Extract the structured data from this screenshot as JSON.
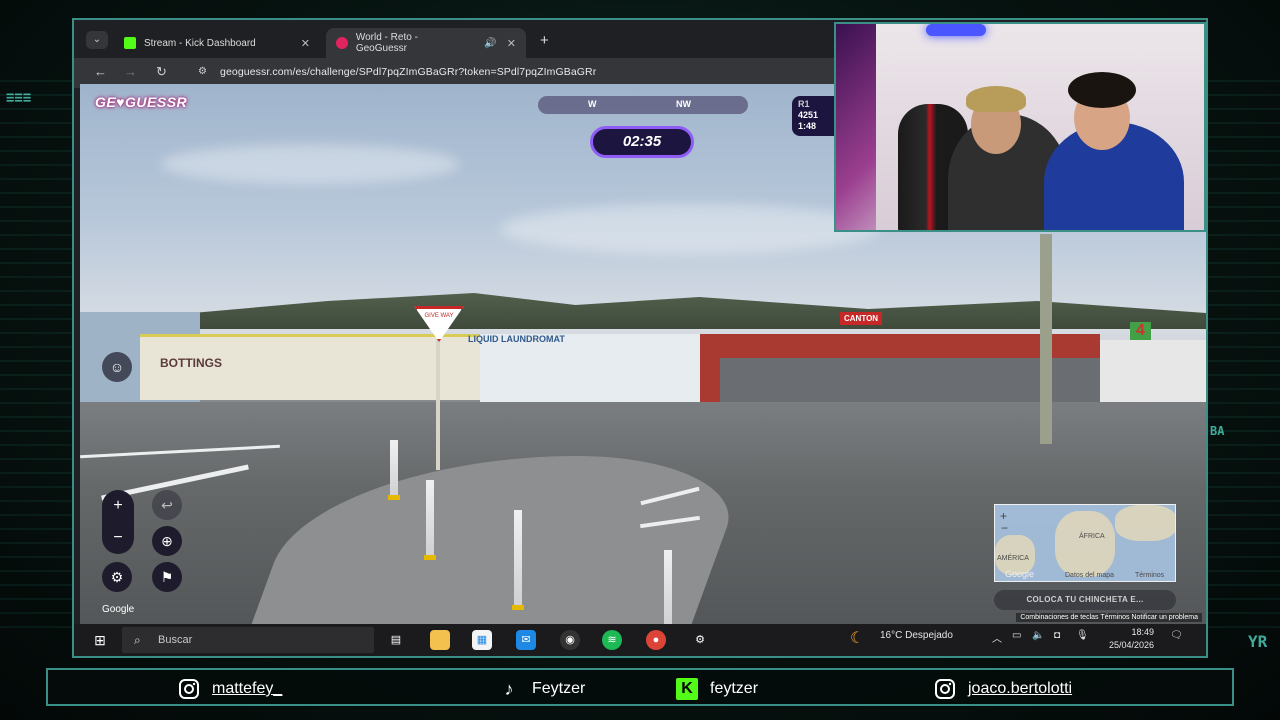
{
  "browser": {
    "tabs": [
      {
        "label": "Stream - Kick Dashboard",
        "icon": "kick-icon"
      },
      {
        "label": "World - Reto - GeoGuessr",
        "icon": "geoguessr-icon",
        "audio": true
      }
    ],
    "url": "geoguessr.com/es/challenge/SPdl7pqZImGBaGRr?token=SPdl7pqZImGBaGRr"
  },
  "game": {
    "logo": "GE♥GUESSR",
    "compass": {
      "w": "W",
      "nw": "NW"
    },
    "timer": "02:35",
    "round_badge": {
      "round": "R1",
      "score": "4251",
      "time": "1:48"
    },
    "street_labels": {
      "sign": "GIVE WAY",
      "store1": "BOTTINGS",
      "store2": "LIQUID LAUNDROMAT",
      "store3": "CANTON",
      "store4": "4"
    },
    "google_watermark": "Google",
    "guess_button": "COLOCA TU CHINCHETA E...",
    "minimap": {
      "africa": "ÁFRICA",
      "america": "AMÉRICA",
      "attribution": "Datos del mapa",
      "terms": "Términos",
      "google": "Google"
    },
    "map_footer": "Combinaciones de teclas   Términos   Notificar un problema"
  },
  "taskbar": {
    "search_placeholder": "Buscar",
    "weather": "16°C  Despejado",
    "time": "18:49",
    "date": "25/04/2026"
  },
  "social": {
    "instagram1": "mattefey_",
    "tiktok": "Feytzer",
    "kick": "feytzer",
    "instagram2": "joaco.bertolotti"
  },
  "overlay_text": {
    "left": "≡≡≡",
    "right1": "BA",
    "right2": "YR"
  },
  "colors": {
    "accent": "#3a8f86",
    "timer_border": "#8f5cf7",
    "kick_green": "#53fc18"
  }
}
